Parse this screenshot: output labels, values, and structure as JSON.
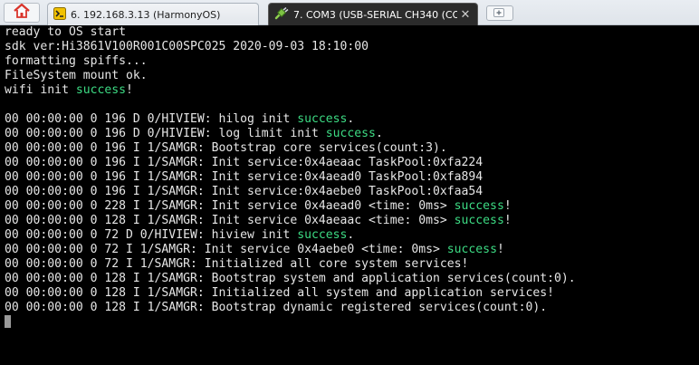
{
  "tabs": [
    {
      "label": "6. 192.168.3.13 (HarmonyOS)",
      "icon": "terminal-icon",
      "active": false
    },
    {
      "label": "7. COM3  (USB-SERIAL CH340 (CO",
      "icon": "serial-plug-icon",
      "active": true,
      "close_label": "✕"
    }
  ],
  "terminal": {
    "lines": [
      {
        "text": "ready to OS start"
      },
      {
        "text": "sdk ver:Hi3861V100R001C00SPC025 2020-09-03 18:10:00"
      },
      {
        "text": "formatting spiffs..."
      },
      {
        "text": "FileSystem mount ok."
      },
      {
        "text": "wifi init ",
        "highlight": "success",
        "tail": "!"
      },
      {
        "text": ""
      },
      {
        "text": "00 00:00:00 0 196 D 0/HIVIEW: hilog init ",
        "highlight": "success",
        "tail": "."
      },
      {
        "text": "00 00:00:00 0 196 D 0/HIVIEW: log limit init ",
        "highlight": "success",
        "tail": "."
      },
      {
        "text": "00 00:00:00 0 196 I 1/SAMGR: Bootstrap core services(count:3)."
      },
      {
        "text": "00 00:00:00 0 196 I 1/SAMGR: Init service:0x4aeaac TaskPool:0xfa224"
      },
      {
        "text": "00 00:00:00 0 196 I 1/SAMGR: Init service:0x4aead0 TaskPool:0xfa894"
      },
      {
        "text": "00 00:00:00 0 196 I 1/SAMGR: Init service:0x4aebe0 TaskPool:0xfaa54"
      },
      {
        "text": "00 00:00:00 0 228 I 1/SAMGR: Init service 0x4aead0 <time: 0ms> ",
        "highlight": "success",
        "tail": "!"
      },
      {
        "text": "00 00:00:00 0 128 I 1/SAMGR: Init service 0x4aeaac <time: 0ms> ",
        "highlight": "success",
        "tail": "!"
      },
      {
        "text": "00 00:00:00 0 72 D 0/HIVIEW: hiview init ",
        "highlight": "success",
        "tail": "."
      },
      {
        "text": "00 00:00:00 0 72 I 1/SAMGR: Init service 0x4aebe0 <time: 0ms> ",
        "highlight": "success",
        "tail": "!"
      },
      {
        "text": "00 00:00:00 0 72 I 1/SAMGR: Initialized all core system services!"
      },
      {
        "text": "00 00:00:00 0 128 I 1/SAMGR: Bootstrap system and application services(count:0)."
      },
      {
        "text": "00 00:00:00 0 128 I 1/SAMGR: Initialized all system and application services!"
      },
      {
        "text": "00 00:00:00 0 128 I 1/SAMGR: Bootstrap dynamic registered services(count:0)."
      }
    ]
  },
  "colors": {
    "background": "#000000",
    "text": "#e6e6e6",
    "success": "#3ddc84",
    "home_icon": "#d9342b"
  }
}
